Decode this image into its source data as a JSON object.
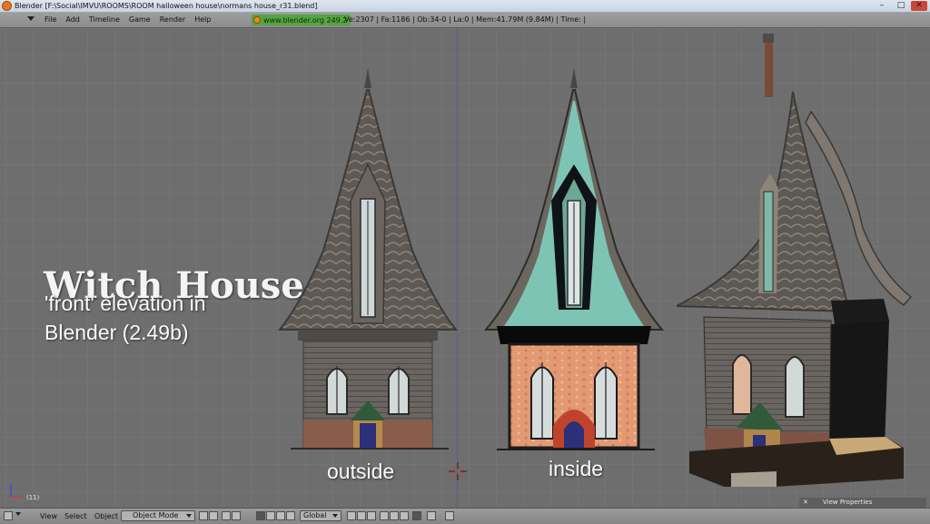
{
  "window": {
    "title": "Blender [F:\\Social\\IMVU\\ROOMS\\ROOM halloween house\\normans house_r31.blend]",
    "minimize": "–",
    "maximize": "□",
    "close": "✕"
  },
  "menu": {
    "items": [
      "File",
      "Add",
      "Timeline",
      "Game",
      "Render",
      "Help"
    ]
  },
  "info": {
    "version": "www.blender.org 249.2",
    "stats": "Ve:2307 | Fa:1186 | Ob:34-0 | La:0 | Mem:41.79M (9.84M) | Time: |"
  },
  "viewport": {
    "headline": "Witch House",
    "subline": "'front' elevation in Blender (2.49b)",
    "caption_outside": "outside",
    "caption_inside": "inside",
    "frame": "(11)",
    "view_properties": "View Properties"
  },
  "footer": {
    "view": "View",
    "select": "Select",
    "object": "Object",
    "mode": "Object Mode",
    "orientation": "Global"
  },
  "colors": {
    "viewport_bg": "#6e6e6e",
    "version_pill": "#54a53e",
    "roof_teal": "#7ec4b4",
    "brick_orange": "#e29a74"
  }
}
